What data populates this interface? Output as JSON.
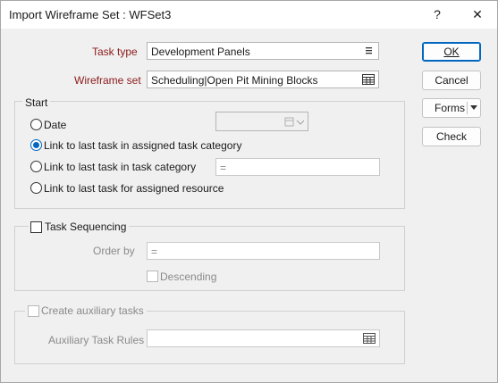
{
  "window": {
    "title": "Import Wireframe Set : WFSet3",
    "help_label": "?",
    "close_label": "✕"
  },
  "task_type": {
    "label": "Task type",
    "value": "Development Panels"
  },
  "wireframe_set": {
    "label": "Wireframe set",
    "value": "Scheduling|Open Pit Mining Blocks"
  },
  "start": {
    "title": "Start",
    "date_label": "Date",
    "link_assigned_category_label": "Link to last task in assigned task category",
    "link_category_label": "Link to last task in task category",
    "link_category_value": "=",
    "link_resource_label": "Link to last task for assigned resource",
    "selected": "link_assigned_category"
  },
  "sequencing": {
    "title": "Task Sequencing",
    "order_by_label": "Order by",
    "order_by_value": "=",
    "descending_label": "Descending"
  },
  "auxiliary": {
    "title": "Create auxiliary tasks",
    "rules_label": "Auxiliary Task Rules",
    "rules_value": ""
  },
  "buttons": {
    "ok": "OK",
    "cancel": "Cancel",
    "forms": "Forms",
    "check": "Check"
  }
}
